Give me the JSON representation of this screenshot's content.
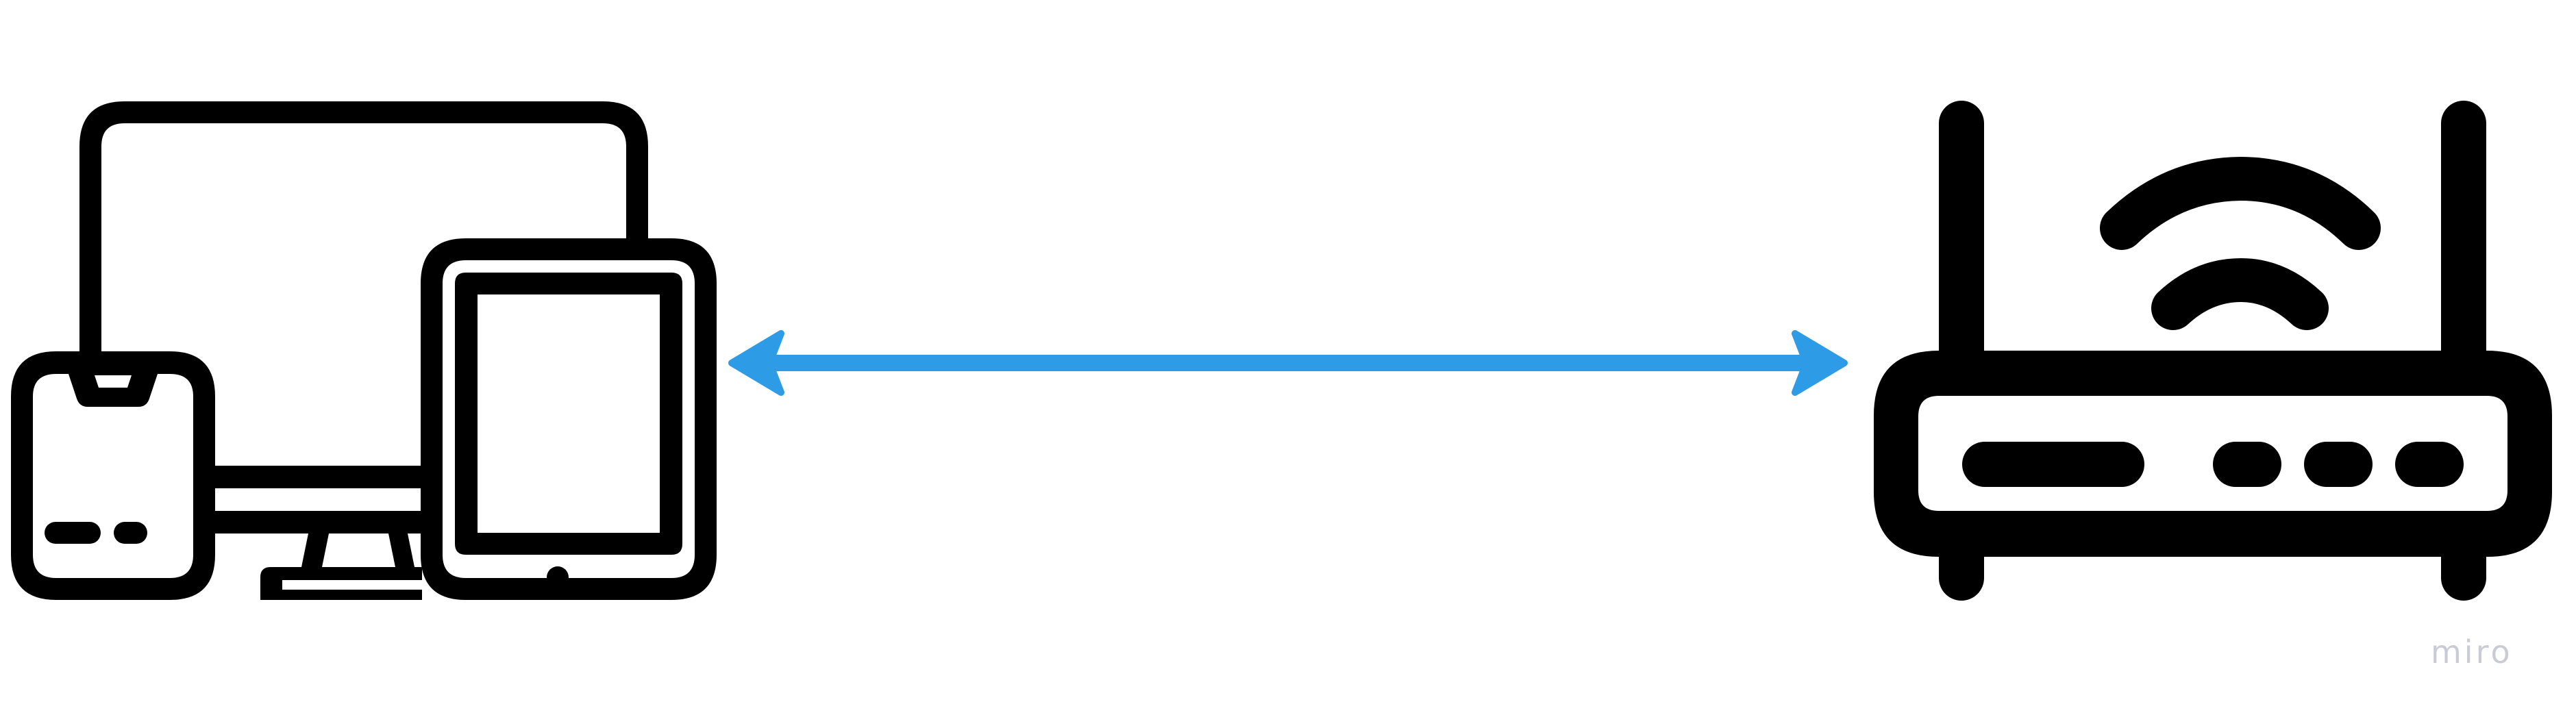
{
  "colors": {
    "icon": "#000000",
    "connector": "#2d9be5",
    "background": "#ffffff",
    "watermark": "#c9ccd6"
  },
  "nodes": [
    {
      "id": "devices",
      "icon": "multi-device-icon"
    },
    {
      "id": "router",
      "icon": "wifi-router-icon"
    }
  ],
  "connector": {
    "from": "devices",
    "to": "router",
    "style": "double-arrow"
  },
  "watermark": {
    "text": "miro"
  }
}
